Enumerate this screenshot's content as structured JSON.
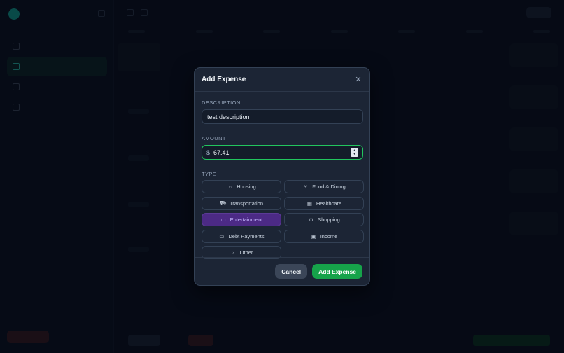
{
  "modal": {
    "title": "Add Expense",
    "close_icon": "close-icon",
    "description": {
      "label": "DESCRIPTION",
      "value": "test description"
    },
    "amount": {
      "label": "AMOUNT",
      "currency_symbol": "$",
      "value": "67.41",
      "stepper_up": "▲",
      "stepper_down": "▼"
    },
    "type": {
      "label": "TYPE",
      "selected": "Entertainment",
      "options": [
        {
          "label": "Housing",
          "icon": "home-icon",
          "glyph": "⌂"
        },
        {
          "label": "Food & Dining",
          "icon": "utensils-icon",
          "glyph": "⑂"
        },
        {
          "label": "Transportation",
          "icon": "car-icon",
          "glyph": "⛟"
        },
        {
          "label": "Healthcare",
          "icon": "building-icon",
          "glyph": "▦"
        },
        {
          "label": "Entertainment",
          "icon": "tv-icon",
          "glyph": "▭"
        },
        {
          "label": "Shopping",
          "icon": "bag-icon",
          "glyph": "◘"
        },
        {
          "label": "Debt Payments",
          "icon": "credit-card-icon",
          "glyph": "▭"
        },
        {
          "label": "Income",
          "icon": "briefcase-icon",
          "glyph": "▣"
        },
        {
          "label": "Other",
          "icon": "question-icon",
          "glyph": "?"
        }
      ]
    },
    "footer": {
      "cancel_label": "Cancel",
      "submit_label": "Add Expense"
    }
  },
  "colors": {
    "accent_selected": "#4c2a85",
    "primary_button": "#16a34a",
    "focus_border": "#22c55e",
    "modal_bg": "#1c2535",
    "page_bg": "#0b1120"
  }
}
